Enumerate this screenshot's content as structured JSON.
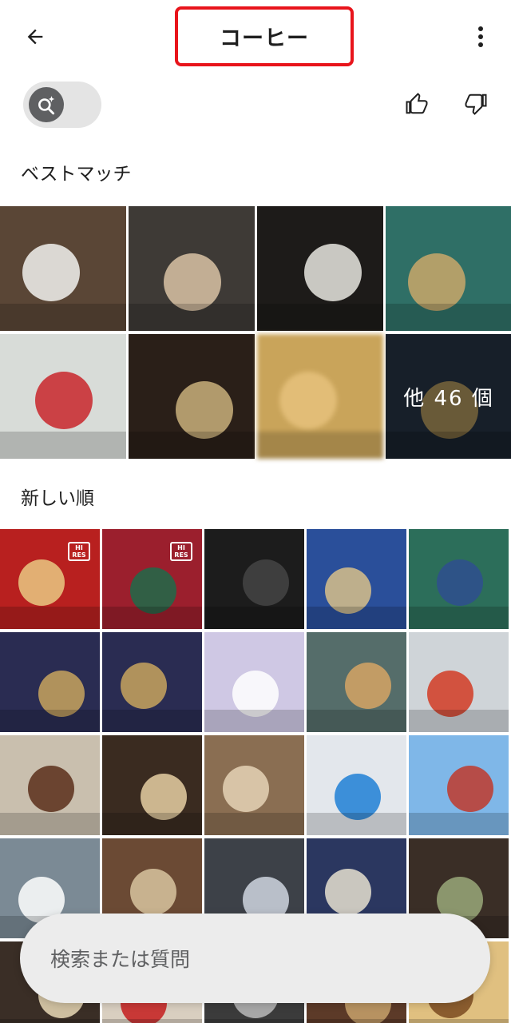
{
  "header": {
    "title": "コーヒー",
    "back_icon": "arrow-back-icon",
    "more_icon": "more-vert-icon",
    "highlight_color": "#e8141b"
  },
  "filters": {
    "ai_toggle_icon": "ai-search-icon",
    "like_icon": "thumb-up-icon",
    "dislike_icon": "thumb-down-icon"
  },
  "sections": {
    "best_match": "ベストマッチ",
    "recent": "新しい順"
  },
  "best_match_tiles": [
    {
      "bg": "#5a4636",
      "accent": "#f2f2ee",
      "desc": "latte-cups"
    },
    {
      "bg": "#3e3a36",
      "accent": "#d9c3a5",
      "desc": "latte-table"
    },
    {
      "bg": "#1d1b19",
      "accent": "#e8e6e1",
      "desc": "espresso-saucer"
    },
    {
      "bg": "#2f6f66",
      "accent": "#c9a86a",
      "desc": "cream-drink-cake"
    },
    {
      "bg": "#d8dcd8",
      "accent": "#c9262c",
      "desc": "espresso-checkered"
    },
    {
      "bg": "#2a1f18",
      "accent": "#c9b07b",
      "desc": "tokyo-craft-beer"
    },
    {
      "bg": "#c9a45a",
      "accent": "#e6c27c",
      "desc": "blurred"
    },
    {
      "bg": "#24303f",
      "accent": "#b99a5a",
      "desc": "inoda-coffee-bag",
      "more_label": "他 46 個"
    }
  ],
  "recent_tiles": [
    {
      "bg": "#b8201f",
      "accent": "#e9c983",
      "hires": "HI RES"
    },
    {
      "bg": "#9b1f2d",
      "accent": "#1f6b4a",
      "hires": "HI RES"
    },
    {
      "bg": "#1c1c1c",
      "accent": "#444444"
    },
    {
      "bg": "#2a4f9a",
      "accent": "#d8c08a"
    },
    {
      "bg": "#2c6e5a",
      "accent": "#2f4f8f"
    },
    {
      "bg": "#2a2c52",
      "accent": "#c8a55e"
    },
    {
      "bg": "#2a2c52",
      "accent": "#c8a55e"
    },
    {
      "bg": "#cfc8e4",
      "accent": "#ffffff"
    },
    {
      "bg": "#556d6a",
      "accent": "#d6a564"
    },
    {
      "bg": "#cfd4d8",
      "accent": "#d23b24"
    },
    {
      "bg": "#c9bfae",
      "accent": "#5a2e1a"
    },
    {
      "bg": "#3a2b20",
      "accent": "#e6cfa3"
    },
    {
      "bg": "#8a6e52",
      "accent": "#e5d3b6"
    },
    {
      "bg": "#e3e7ec",
      "accent": "#1f7fd6"
    },
    {
      "bg": "#7fb7e8",
      "accent": "#c0392b"
    },
    {
      "bg": "#7b8a95",
      "accent": "#ffffff"
    },
    {
      "bg": "#6b4a34",
      "accent": "#d8c4a0"
    },
    {
      "bg": "#3d4148",
      "accent": "#cfd6e0"
    },
    {
      "bg": "#2b3760",
      "accent": "#e6e0d0"
    },
    {
      "bg": "#3a2e26",
      "accent": "#9aa87a"
    },
    {
      "bg": "#3a2e26",
      "accent": "#e9d8b6"
    },
    {
      "bg": "#d9cfc0",
      "accent": "#c41d1d"
    },
    {
      "bg": "#3b3b3b",
      "accent": "#bbbbbb"
    },
    {
      "bg": "#5c3a28",
      "accent": "#c7a26b"
    },
    {
      "bg": "#e0c080",
      "accent": "#7a4a20"
    }
  ],
  "search": {
    "placeholder": "検索または質問"
  }
}
